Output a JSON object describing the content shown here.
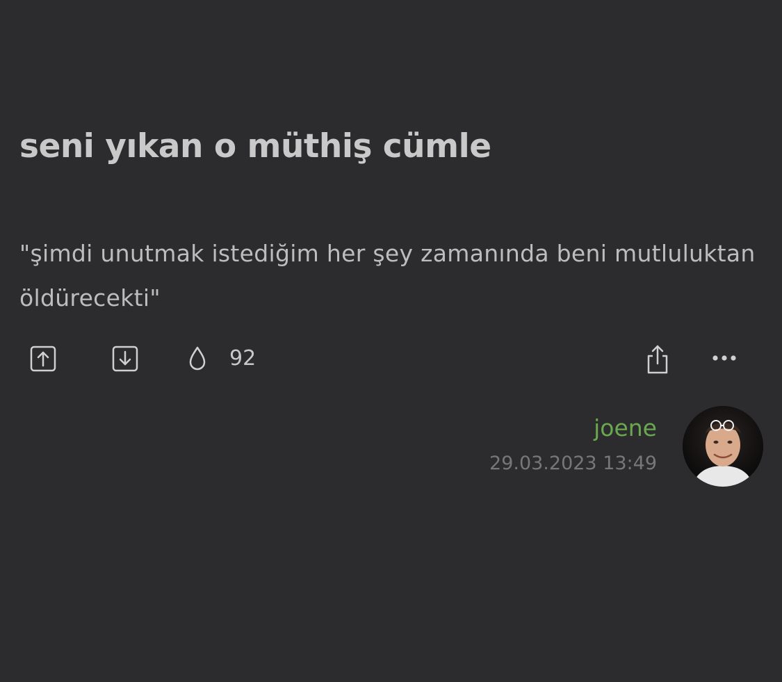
{
  "entry": {
    "title": "seni yıkan o müthiş cümle",
    "text": "\"şimdi unutmak istediğim her şey zamanında beni mutluluktan öldürecekti\"",
    "favorite_count": "92"
  },
  "author": {
    "nickname": "joene",
    "date": "29.03.2023 13:49"
  },
  "icons": {
    "upvote": "upvote-icon",
    "downvote": "downvote-icon",
    "favorite": "drop-icon",
    "share": "share-icon",
    "more": "more-dots-icon"
  },
  "colors": {
    "background": "#2c2c2e",
    "title": "#c9c9c9",
    "text": "#bdbdbd",
    "author": "#6aa84f",
    "date": "#777777"
  }
}
